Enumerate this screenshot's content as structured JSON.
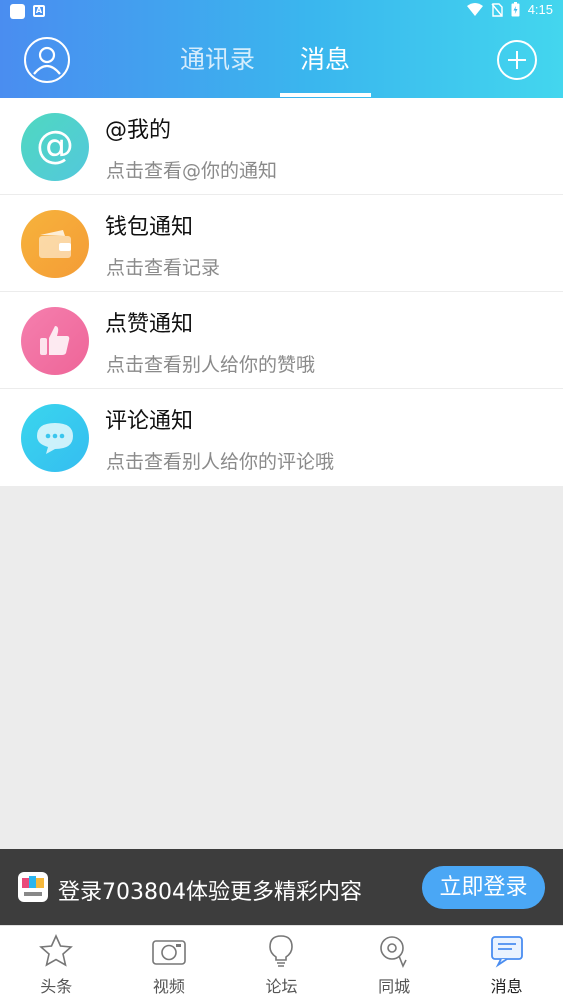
{
  "status_bar": {
    "time": "4:15"
  },
  "header": {
    "tabs": [
      {
        "label": "通讯录",
        "active": false
      },
      {
        "label": "消息",
        "active": true
      }
    ],
    "accent_gradient": [
      "#4a8df0",
      "#43d6ee"
    ]
  },
  "messages": [
    {
      "title": "@我的",
      "subtitle": "点击查看@你的通知",
      "icon": "at-icon",
      "color": "#4fd3c4"
    },
    {
      "title": "钱包通知",
      "subtitle": "点击查看记录",
      "icon": "wallet-icon",
      "color": "#f5a637"
    },
    {
      "title": "点赞通知",
      "subtitle": "点击查看别人给你的赞哦",
      "icon": "thumbs-up-icon",
      "color": "#f06d9f"
    },
    {
      "title": "评论通知",
      "subtitle": "点击查看别人给你的评论哦",
      "icon": "comment-icon",
      "color": "#3ac6ee"
    }
  ],
  "banner": {
    "text": "登录703804体验更多精彩内容",
    "button_label": "立即登录",
    "button_color": "#4aa7f5"
  },
  "bottom_nav": [
    {
      "label": "头条",
      "icon": "star-icon",
      "active": false
    },
    {
      "label": "视频",
      "icon": "camera-icon",
      "active": false
    },
    {
      "label": "论坛",
      "icon": "lightbulb-icon",
      "active": false
    },
    {
      "label": "同城",
      "icon": "location-icon",
      "active": false
    },
    {
      "label": "消息",
      "icon": "message-icon",
      "active": true
    }
  ]
}
